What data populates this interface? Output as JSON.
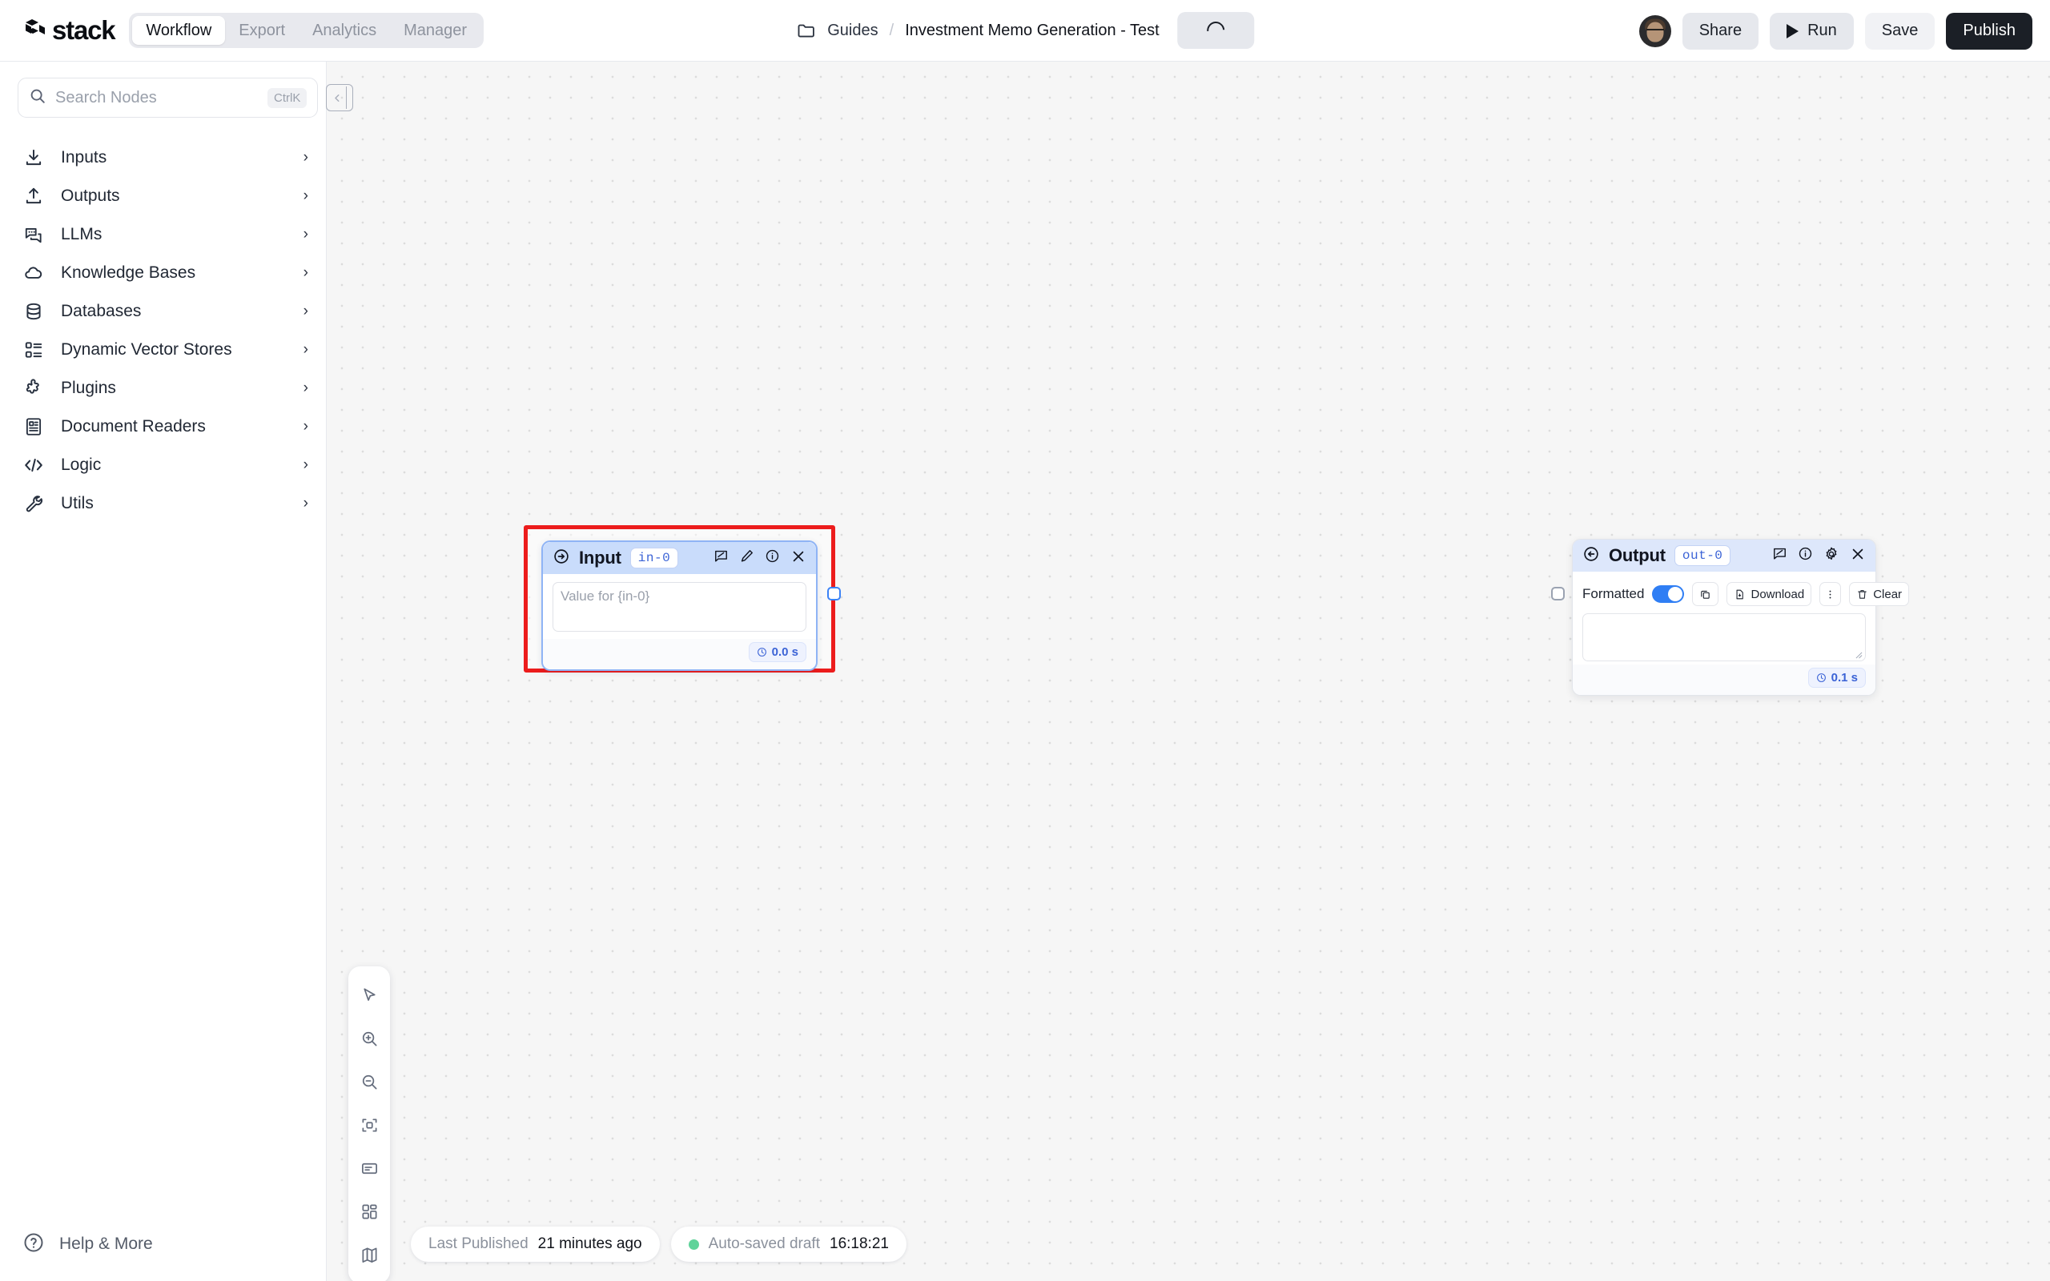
{
  "header": {
    "brand": "stack",
    "brand_logo_icon": "stack-cubes-logo",
    "tabs": [
      {
        "label": "Workflow",
        "active": true
      },
      {
        "label": "Export",
        "active": false
      },
      {
        "label": "Analytics",
        "active": false
      },
      {
        "label": "Manager",
        "active": false
      }
    ],
    "breadcrumb": {
      "folder_icon": "folder-icon",
      "parent": "Guides",
      "separator": "/",
      "title": "Investment Memo Generation - Test"
    },
    "status_button": {
      "icon": "loading-spinner-icon",
      "label": ""
    },
    "avatar_name": "user-avatar",
    "actions": [
      {
        "label": "Share",
        "style": "grey",
        "icon": ""
      },
      {
        "label": "Run",
        "style": "grey",
        "icon": "play-icon"
      },
      {
        "label": "Save",
        "style": "light",
        "icon": ""
      },
      {
        "label": "Publish",
        "style": "dark",
        "icon": ""
      }
    ]
  },
  "sidebar": {
    "search": {
      "placeholder": "Search Nodes",
      "value": "",
      "shortcut": "CtrlK",
      "icon": "search-icon"
    },
    "collapse_icon": "panel-collapse-icon",
    "items": [
      {
        "label": "Inputs",
        "icon": "download-arrow-icon"
      },
      {
        "label": "Outputs",
        "icon": "upload-arrow-icon"
      },
      {
        "label": "LLMs",
        "icon": "chat-bubbles-icon"
      },
      {
        "label": "Knowledge Bases",
        "icon": "cloud-icon"
      },
      {
        "label": "Databases",
        "icon": "database-icon"
      },
      {
        "label": "Dynamic Vector Stores",
        "icon": "list-blocks-icon"
      },
      {
        "label": "Plugins",
        "icon": "puzzle-piece-icon"
      },
      {
        "label": "Document Readers",
        "icon": "document-text-icon"
      },
      {
        "label": "Logic",
        "icon": "code-brackets-icon"
      },
      {
        "label": "Utils",
        "icon": "wrench-icon"
      }
    ],
    "chevron_icon": "chevron-right-icon",
    "help": {
      "label": "Help & More",
      "icon": "question-circle-icon"
    }
  },
  "canvas": {
    "nodes": [
      {
        "id": "input",
        "title": "Input",
        "badge": "in-0",
        "type_icon": "arrow-right-circle-icon",
        "selected": true,
        "field_placeholder": "Value for {in-0}",
        "field_value": "",
        "time_label": "0.0 s",
        "time_icon": "clock-icon",
        "header_actions": [
          "note-icon",
          "pencil-icon",
          "info-icon",
          "close-icon"
        ]
      },
      {
        "id": "output",
        "title": "Output",
        "badge": "out-0",
        "type_icon": "arrow-left-circle-icon",
        "selected": false,
        "formatted_label": "Formatted",
        "formatted_on": true,
        "copy_icon": "copy-icon",
        "download_label": "Download",
        "download_icon": "file-download-icon",
        "more_icon": "kebab-menu-icon",
        "clear_label": "Clear",
        "clear_icon": "trash-icon",
        "value": "",
        "time_label": "0.1 s",
        "time_icon": "clock-icon",
        "header_actions": [
          "note-icon",
          "info-icon",
          "gear-icon",
          "close-icon"
        ]
      }
    ],
    "selection_color": "#ec1c1c"
  },
  "tool_rail": [
    {
      "icon": "cursor-pointer-icon",
      "name": "select-tool"
    },
    {
      "icon": "zoom-in-icon",
      "name": "zoom-in-tool"
    },
    {
      "icon": "zoom-out-icon",
      "name": "zoom-out-tool"
    },
    {
      "icon": "fit-view-icon",
      "name": "fit-view-tool"
    },
    {
      "icon": "sticky-note-icon",
      "name": "note-tool"
    },
    {
      "icon": "grid-layout-icon",
      "name": "layout-tool"
    },
    {
      "icon": "minimap-icon",
      "name": "minimap-tool"
    }
  ],
  "status": {
    "published_label": "Last Published",
    "published_value": "21 minutes ago",
    "draft_label": "Auto-saved draft",
    "draft_value": "16:18:21",
    "draft_dot_color": "#5fd39a"
  }
}
